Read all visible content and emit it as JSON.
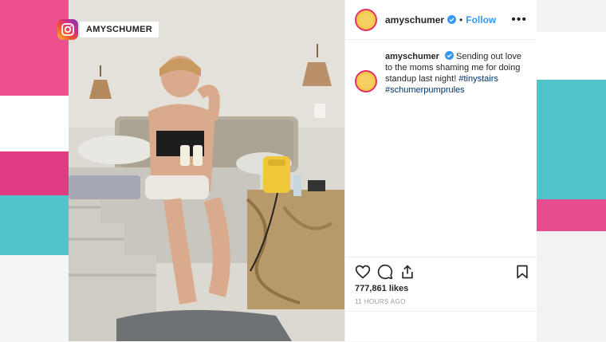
{
  "badge": {
    "platform_icon": "instagram-icon",
    "handle": "AMYSCHUMER"
  },
  "post": {
    "header": {
      "username": "amyschumer",
      "separator": "•",
      "follow_label": "Follow",
      "more_icon": "more-options-icon",
      "more_glyph": "•••"
    },
    "caption": {
      "username": "amyschumer",
      "text": "Sending out love to the moms shaming me for doing standup last night!",
      "hashtags": [
        "#tinystairs",
        "#schumerpumprules"
      ]
    },
    "actions": {
      "like_icon": "heart-icon",
      "comment_icon": "comment-icon",
      "share_icon": "share-icon",
      "save_icon": "bookmark-icon"
    },
    "likes": "777,861 likes",
    "timestamp": "11 HOURS AGO"
  },
  "colors": {
    "accent": "#3897f0",
    "pink": "#ee4f8d",
    "teal": "#4fc5cb"
  }
}
